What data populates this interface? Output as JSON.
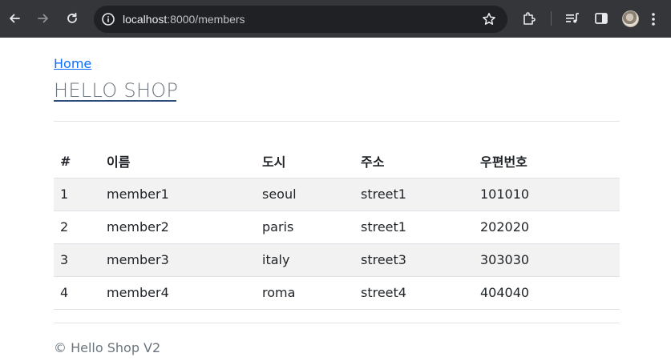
{
  "browser": {
    "url_host": "localhost",
    "url_path": ":8000/members",
    "icons": [
      "back-arrow-icon",
      "forward-arrow-icon",
      "reload-icon",
      "info-icon",
      "star-icon",
      "extensions-icon",
      "media-control-icon",
      "side-panel-icon",
      "profile-avatar",
      "more-menu-icon"
    ]
  },
  "page": {
    "home_link": "Home",
    "title": "HELLO SHOP",
    "footer": "© Hello Shop V2"
  },
  "table": {
    "headers": [
      "#",
      "이름",
      "도시",
      "주소",
      "우편번호"
    ],
    "rows": [
      [
        "1",
        "member1",
        "seoul",
        "street1",
        "101010"
      ],
      [
        "2",
        "member2",
        "paris",
        "street1",
        "202020"
      ],
      [
        "3",
        "member3",
        "italy",
        "street3",
        "303030"
      ],
      [
        "4",
        "member4",
        "roma",
        "street4",
        "404040"
      ]
    ]
  },
  "colors": {
    "chrome_bg": "#35363a",
    "omnibox_bg": "#202124",
    "link": "#0d6efd",
    "muted_text": "#6c757d",
    "stripe": "#f2f2f2"
  }
}
